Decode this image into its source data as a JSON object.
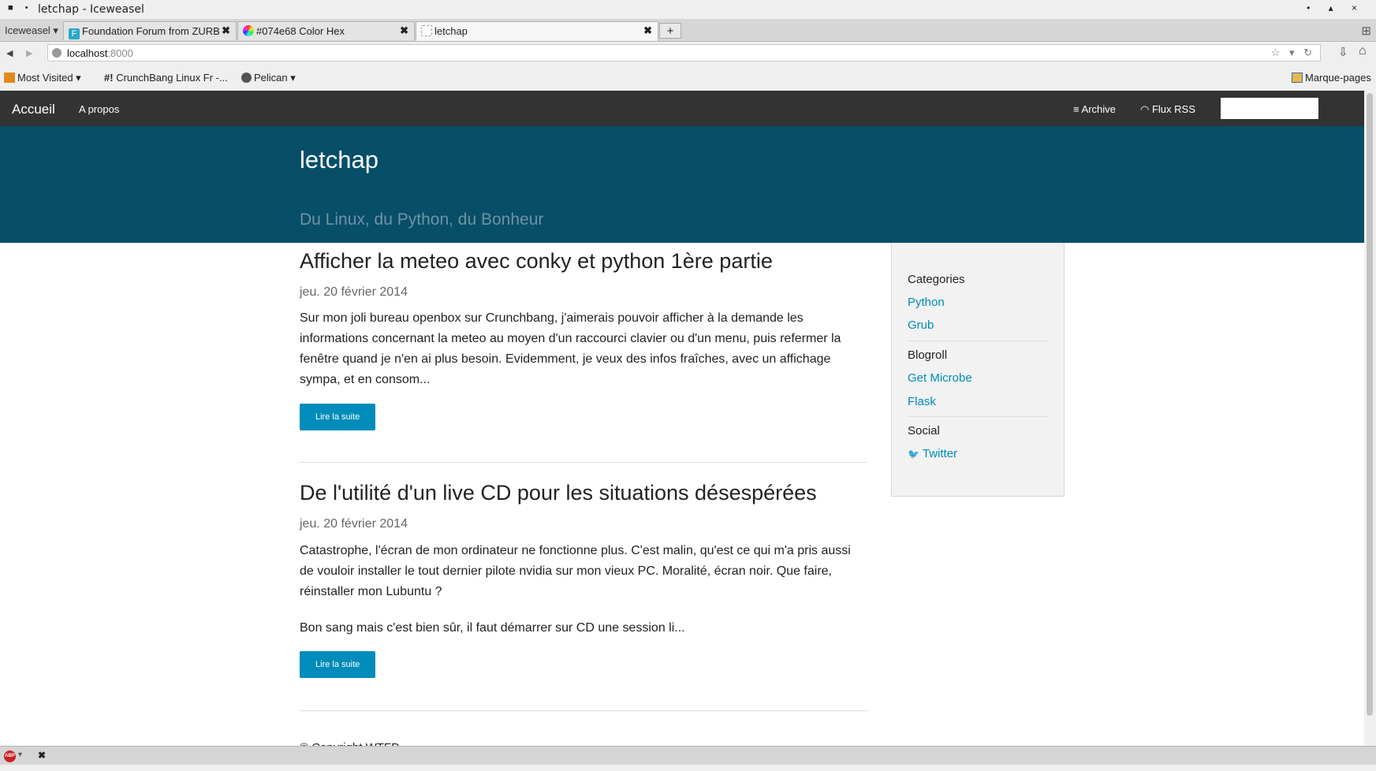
{
  "window": {
    "title": "letchap - Iceweasel",
    "sys_icons": "■ •",
    "controls": "• ▴ ×"
  },
  "browser": {
    "app_menu": "Iceweasel ▾",
    "tabs": [
      {
        "label": "Foundation Forum from ZURB",
        "favicon_color": "#2ba6cb",
        "favicon_char": "F"
      },
      {
        "label": "#074e68 Color Hex",
        "favicon_color": "#c03cc0",
        "favicon_char": ""
      },
      {
        "label": "letchap",
        "favicon_color": "#ffffff",
        "favicon_char": ""
      }
    ],
    "tab_close": "✖",
    "new_tab": "+",
    "url_host": "localhost",
    "url_port": ":8000",
    "url_right_icons": "☆ ▾ ↻",
    "nav_back": "◀",
    "nav_forward": "▶",
    "nav_download": "⇩",
    "nav_home": "⌂",
    "tabs_list_icon": "⊞",
    "bookmarks": [
      {
        "label": "Most Visited ▾",
        "icon_color": "#e08a1e"
      },
      {
        "label": "CrunchBang Linux Fr -...",
        "icon_color": ""
      },
      {
        "label": "Pelican ▾",
        "icon_color": "#555555"
      }
    ],
    "bookmarks_prefix": "#!",
    "marque_pages": "Marque-pages"
  },
  "site": {
    "brand": "Accueil",
    "nav_apropos": "A propos",
    "nav_archive": "Archive",
    "nav_rss": "Flux RSS",
    "archive_icon": "≡",
    "rss_icon": "◠",
    "header_color": "#074e68",
    "title": "letchap",
    "tagline": "Du Linux, du Python, du Bonheur"
  },
  "articles": [
    {
      "title": "Afficher la meteo avec conky et python 1ère partie",
      "date": "jeu. 20 février 2014",
      "paragraphs": [
        "Sur mon joli bureau openbox sur Crunchbang, j'aimerais pouvoir afficher à la demande les informations concernant la meteo au moyen d'un raccourci clavier ou d'un menu, puis refermer la fenêtre quand je n'en ai plus besoin. Evidemment, je veux des infos fraîches, avec un affichage sympa, et en consom..."
      ],
      "button": "Lire la suite"
    },
    {
      "title": "De l'utilité d'un live CD pour les situations désespérées",
      "date": "jeu. 20 février 2014",
      "paragraphs": [
        "Catastrophe, l'écran de mon ordinateur ne fonctionne plus. C'est malin, qu'est ce qui m'a pris aussi de vouloir installer le tout dernier pilote nvidia sur mon vieux PC. Moralité, écran noir. Que faire, réinstaller mon Lubuntu ?",
        "Bon sang mais c'est bien sûr, il faut démarrer sur CD une session li..."
      ],
      "button": "Lire la suite"
    }
  ],
  "sidebar": {
    "categories_title": "Categories",
    "categories": [
      "Python",
      "Grub"
    ],
    "blogroll_title": "Blogroll",
    "blogroll": [
      "Get Microbe",
      "Flask"
    ],
    "social_title": "Social",
    "twitter_icon": "🐦",
    "twitter": "Twitter"
  },
  "footer": {
    "copyright": "© Copyright WTFP"
  },
  "statusbar": {
    "abp_label": "ABP",
    "abp_menu": "▾",
    "close": "✖"
  }
}
